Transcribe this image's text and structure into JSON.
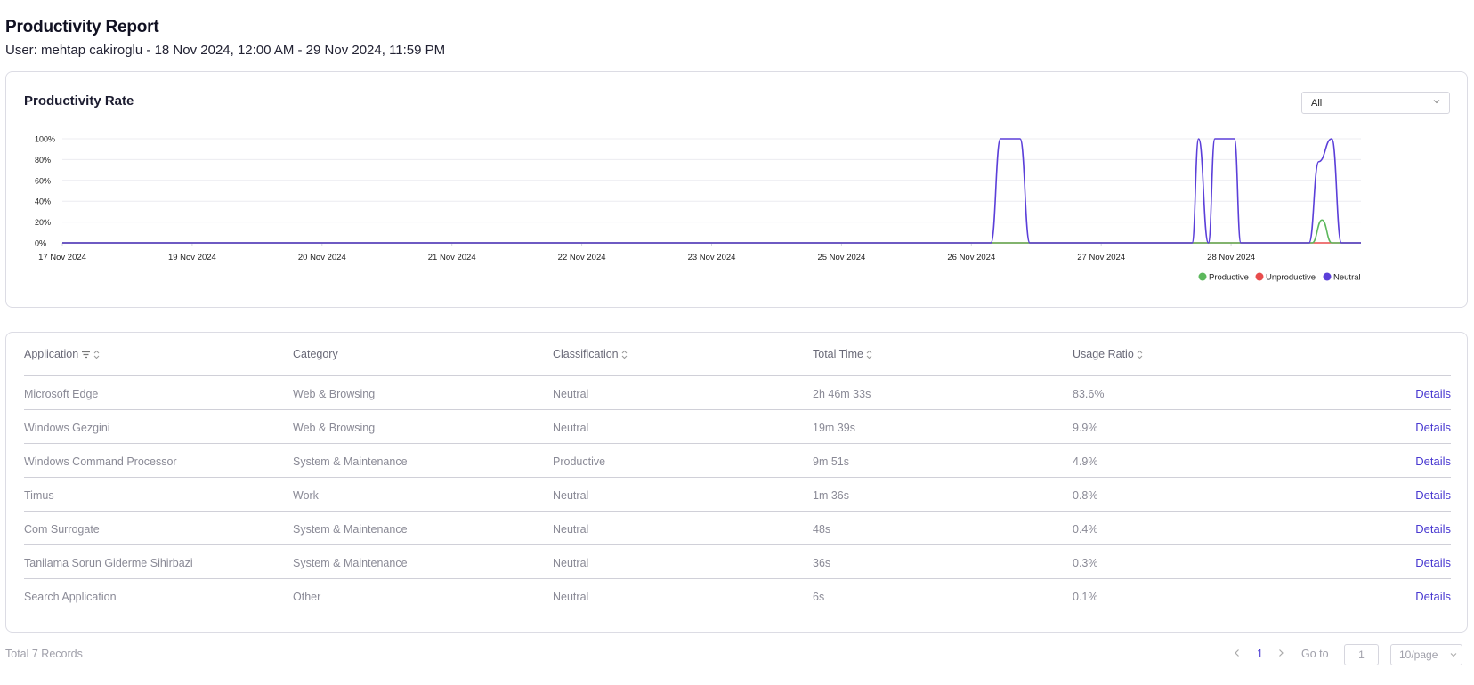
{
  "header": {
    "title": "Productivity Report",
    "subtitle": "User: mehtap cakiroglu - 18 Nov 2024, 12:00 AM - 29 Nov 2024, 11:59 PM"
  },
  "chart_card": {
    "title": "Productivity Rate",
    "filter_value": "All"
  },
  "chart_data": {
    "type": "line",
    "title": "Productivity Rate",
    "xlabel": "",
    "ylabel": "",
    "y_ticks": [
      "100%",
      "80%",
      "60%",
      "40%",
      "20%",
      "0%"
    ],
    "ylim": [
      0,
      100
    ],
    "x_ticks": [
      "17 Nov 2024",
      "19 Nov 2024",
      "20 Nov 2024",
      "21 Nov 2024",
      "22 Nov 2024",
      "23 Nov 2024",
      "25 Nov 2024",
      "26 Nov 2024",
      "27 Nov 2024",
      "28 Nov 2024"
    ],
    "x_domain": [
      0,
      20
    ],
    "legend_position": "bottom-right",
    "grid": true,
    "series": [
      {
        "name": "Productive",
        "color": "#5cb85c",
        "points": [
          [
            0,
            0
          ],
          [
            19.25,
            0
          ],
          [
            19.4,
            22
          ],
          [
            19.55,
            0
          ],
          [
            20,
            0
          ]
        ]
      },
      {
        "name": "Unproductive",
        "color": "#e84c4c",
        "points": [
          [
            0,
            0
          ],
          [
            20,
            0
          ]
        ]
      },
      {
        "name": "Neutral",
        "color": "#5b3fd9",
        "points": [
          [
            0,
            0
          ],
          [
            14.3,
            0
          ],
          [
            14.45,
            100
          ],
          [
            14.75,
            100
          ],
          [
            14.9,
            0
          ],
          [
            17.4,
            0
          ],
          [
            17.5,
            100
          ],
          [
            17.65,
            0
          ],
          [
            17.75,
            100
          ],
          [
            18.05,
            100
          ],
          [
            18.15,
            0
          ],
          [
            19.2,
            0
          ],
          [
            19.35,
            78
          ],
          [
            19.55,
            100
          ],
          [
            19.7,
            0
          ],
          [
            20,
            0
          ]
        ]
      }
    ]
  },
  "table": {
    "columns": [
      "Application",
      "Category",
      "Classification",
      "Total Time",
      "Usage Ratio"
    ],
    "details_label": "Details",
    "rows": [
      [
        "Microsoft Edge",
        "Web & Browsing",
        "Neutral",
        "2h 46m 33s",
        "83.6%"
      ],
      [
        "Windows Gezgini",
        "Web & Browsing",
        "Neutral",
        "19m 39s",
        "9.9%"
      ],
      [
        "Windows Command Processor",
        "System & Maintenance",
        "Productive",
        "9m 51s",
        "4.9%"
      ],
      [
        "Timus",
        "Work",
        "Neutral",
        "1m 36s",
        "0.8%"
      ],
      [
        "Com Surrogate",
        "System & Maintenance",
        "Neutral",
        "48s",
        "0.4%"
      ],
      [
        "Tanilama Sorun Giderme Sihirbazi",
        "System & Maintenance",
        "Neutral",
        "36s",
        "0.3%"
      ],
      [
        "Search Application",
        "Other",
        "Neutral",
        "6s",
        "0.1%"
      ]
    ]
  },
  "footer": {
    "total": "Total 7 Records",
    "current_page": "1",
    "goto_label": "Go to",
    "goto_value": "1",
    "page_size": "10/page"
  }
}
